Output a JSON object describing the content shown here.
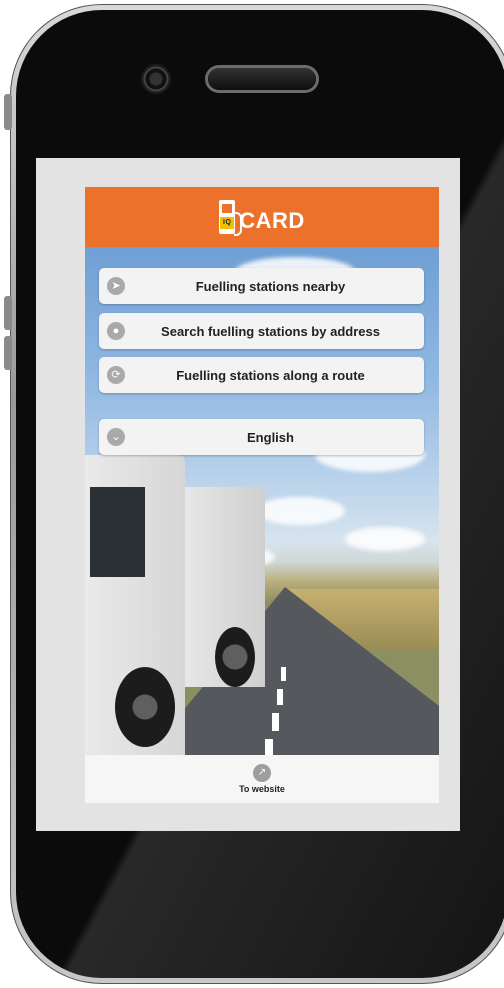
{
  "app": {
    "brand": "CARD",
    "brand_badge": "IQ"
  },
  "menu": {
    "items": [
      {
        "label": "Fuelling stations nearby",
        "icon": "location-arrow-icon"
      },
      {
        "label": "Search fuelling stations by address",
        "icon": "map-pin-icon"
      },
      {
        "label": "Fuelling stations along a route",
        "icon": "route-icon"
      }
    ],
    "language": {
      "label": "English",
      "icon": "chevron-down-icon"
    }
  },
  "footer": {
    "website_label": "To website",
    "website_icon": "external-link-icon"
  },
  "colors": {
    "header": "#ec712b",
    "button_bg": "#f3f3f3",
    "icon_gray": "#a9a9a9"
  }
}
